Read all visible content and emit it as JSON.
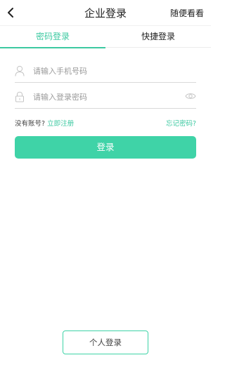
{
  "header": {
    "back_icon": "chevron-left-icon",
    "title": "企业登录",
    "action_label": "随便看看"
  },
  "tabs": [
    {
      "label": "密码登录",
      "active": true
    },
    {
      "label": "快捷登录",
      "active": false
    }
  ],
  "form": {
    "phone": {
      "placeholder": "请输入手机号码",
      "value": "",
      "icon": "user-icon"
    },
    "password": {
      "placeholder": "请输入登录密码",
      "value": "",
      "icon": "lock-icon",
      "toggle_icon": "eye-icon"
    }
  },
  "links": {
    "no_account": "没有账号?",
    "register": "立即注册",
    "forgot": "忘记密码?"
  },
  "login_button": "登录",
  "personal_login_button": "个人登录",
  "colors": {
    "accent": "#3cc9a1",
    "button": "#3fd3a7"
  }
}
